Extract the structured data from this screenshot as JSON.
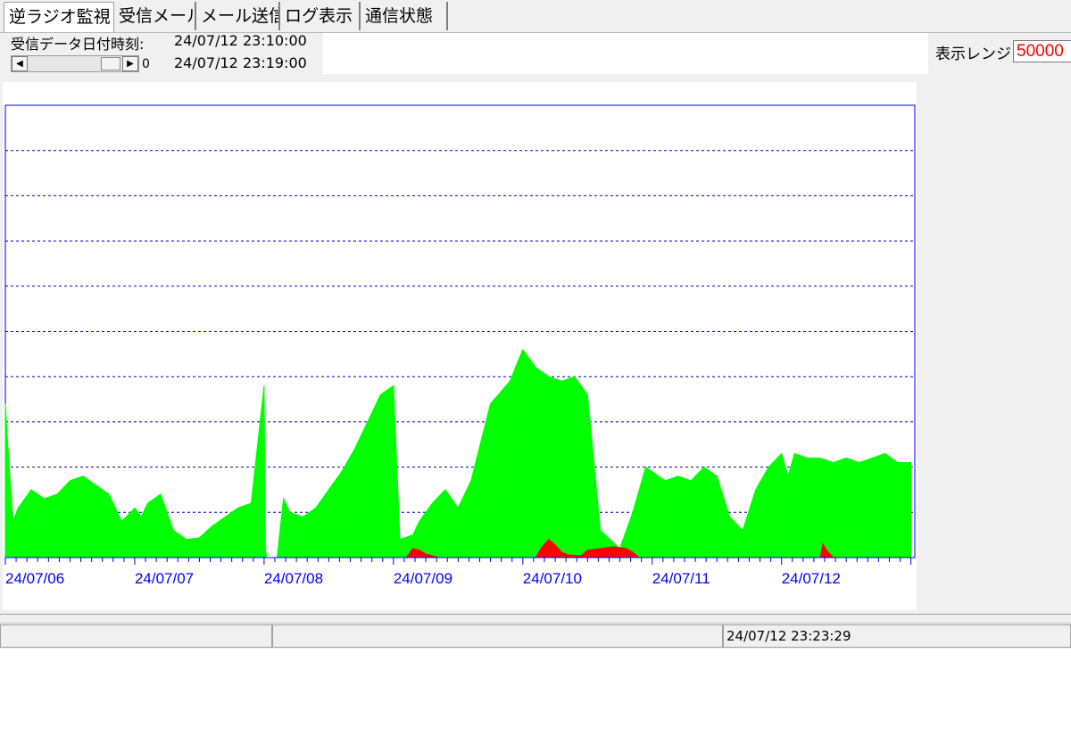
{
  "tabs": [
    {
      "label": "逆ラジオ監視",
      "active": true
    },
    {
      "label": "受信メール",
      "active": false
    },
    {
      "label": "メール送信",
      "active": false
    },
    {
      "label": "ログ表示",
      "active": false
    },
    {
      "label": "通信状態",
      "active": false
    }
  ],
  "info": {
    "received_label": "受信データ日付時刻:",
    "time_start": "24/07/12 23:10:00",
    "time_end": "24/07/12 23:19:00",
    "scroll_value": "0"
  },
  "range": {
    "label": "表示レンジ:",
    "value": "50000"
  },
  "status": {
    "panel1": "",
    "panel2": "",
    "timestamp": "24/07/12 23:23:29"
  },
  "colors": {
    "green_series": "#00ff00",
    "red_series": "#ff0000",
    "axis": "#0000ff",
    "grid": "#0000cc"
  },
  "chart_data": {
    "type": "area",
    "ylim": [
      0,
      50000
    ],
    "grid": "dashed horizontal",
    "x_tick_labels": [
      "24/07/06",
      "24/07/07",
      "24/07/08",
      "24/07/09",
      "24/07/10",
      "24/07/11",
      "24/07/12"
    ],
    "x_domain_days": [
      0,
      7.03
    ],
    "series": [
      {
        "color": "#00ff00",
        "x": [
          0,
          0.03,
          0.06,
          0.1,
          0.2,
          0.3,
          0.4,
          0.5,
          0.6,
          0.7,
          0.8,
          0.9,
          1.0,
          1.05,
          1.1,
          1.2,
          1.25,
          1.3,
          1.4,
          1.5,
          1.6,
          1.7,
          1.8,
          1.9,
          2.0,
          2.01,
          2.02,
          2.05,
          2.1,
          2.15,
          2.2,
          2.3,
          2.4,
          2.5,
          2.6,
          2.7,
          2.8,
          2.9,
          3.0,
          3.05,
          3.15,
          3.2,
          3.3,
          3.4,
          3.5,
          3.6,
          3.75,
          3.9,
          4.0,
          4.1,
          4.2,
          4.3,
          4.4,
          4.5,
          4.6,
          4.75,
          4.85,
          4.95,
          5.0,
          5.1,
          5.2,
          5.3,
          5.4,
          5.5,
          5.6,
          5.7,
          5.8,
          5.9,
          6.0,
          6.05,
          6.1,
          6.2,
          6.3,
          6.4,
          6.5,
          6.6,
          6.7,
          6.8,
          6.9,
          6.97,
          7.0
        ],
        "values": [
          17000,
          10000,
          4000,
          5500,
          7500,
          6500,
          7000,
          8500,
          9000,
          8000,
          7000,
          4000,
          5500,
          4500,
          6000,
          7000,
          5000,
          3000,
          2000,
          2200,
          3500,
          4500,
          5500,
          6000,
          19000,
          1000,
          0,
          0,
          0,
          6500,
          5000,
          4500,
          5500,
          7500,
          9500,
          12000,
          15000,
          18000,
          19000,
          2000,
          2500,
          4000,
          6000,
          7500,
          5500,
          8500,
          17000,
          19500,
          23000,
          21000,
          20000,
          19500,
          20000,
          18000,
          3000,
          1000,
          5000,
          10000,
          9500,
          8500,
          9000,
          8500,
          10000,
          9000,
          4500,
          3000,
          7500,
          10000,
          11500,
          9000,
          11500,
          11000,
          11000,
          10500,
          11000,
          10500,
          11000,
          11500,
          10500,
          10500,
          10500
        ]
      },
      {
        "color": "#ff0000",
        "x": [
          3.1,
          3.15,
          3.2,
          3.25,
          3.3,
          3.35,
          4.1,
          4.15,
          4.2,
          4.25,
          4.3,
          4.35,
          4.45,
          4.5,
          4.6,
          4.7,
          4.8,
          4.85,
          4.9,
          6.3,
          6.32,
          6.34,
          6.36,
          6.38,
          6.4
        ],
        "values": [
          0,
          1000,
          800,
          400,
          200,
          0,
          0,
          1200,
          2000,
          1400,
          600,
          300,
          200,
          800,
          1000,
          1200,
          1000,
          600,
          0,
          0,
          1500,
          1000,
          600,
          300,
          0
        ]
      }
    ]
  }
}
